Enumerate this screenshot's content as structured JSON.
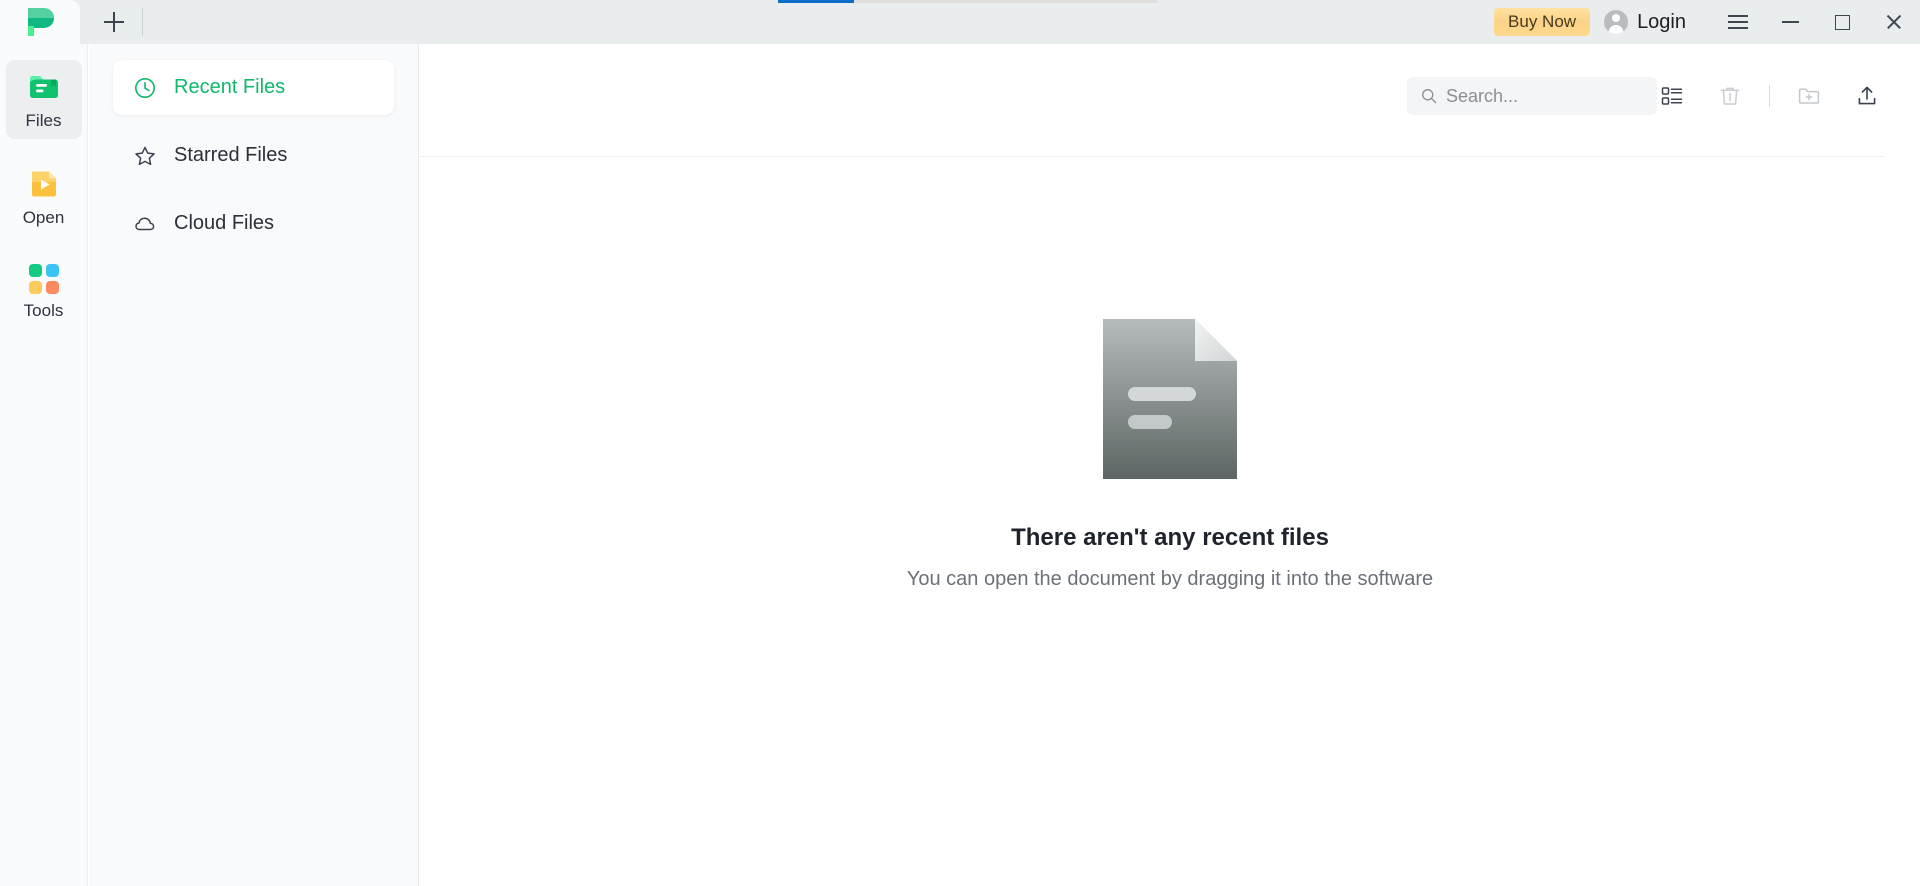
{
  "window": {
    "progress_percent": 20,
    "tab_logo": "app-logo-p",
    "new_tab_label": "+",
    "buy_now_label": "Buy Now",
    "login_label": "Login",
    "menu_icon": "hamburger-menu-icon",
    "minimize_icon": "minimize-icon",
    "maximize_icon": "maximize-icon",
    "close_icon": "close-icon"
  },
  "rail": {
    "items": [
      {
        "label": "Files",
        "icon": "files-folder-icon",
        "active": true
      },
      {
        "label": "Open",
        "icon": "open-file-icon",
        "active": false
      },
      {
        "label": "Tools",
        "icon": "tools-grid-icon",
        "active": false
      }
    ]
  },
  "nav": {
    "items": [
      {
        "label": "Recent Files",
        "icon": "clock-icon",
        "active": true
      },
      {
        "label": "Starred Files",
        "icon": "star-icon",
        "active": false
      },
      {
        "label": "Cloud Files",
        "icon": "cloud-icon",
        "active": false
      }
    ]
  },
  "toolbar": {
    "search_placeholder": "Search...",
    "search_value": "",
    "search_icon": "search-icon",
    "buttons": [
      {
        "name": "list-view-icon",
        "tooltip": "List view"
      },
      {
        "name": "trash-icon",
        "tooltip": "Recycle bin"
      },
      {
        "name": "new-folder-icon",
        "tooltip": "New folder"
      },
      {
        "name": "upload-icon",
        "tooltip": "Upload"
      }
    ]
  },
  "empty_state": {
    "illustration": "document-placeholder-icon",
    "title": "There aren't any recent files",
    "subtitle": "You can open the document by dragging it into the software"
  },
  "colors": {
    "brand_green": "#12b76a",
    "accent_gold": "#fbd288",
    "progress_blue": "#0a6dc9",
    "titlebar_bg": "#e9edee",
    "panel_bg": "#f8fafb"
  }
}
